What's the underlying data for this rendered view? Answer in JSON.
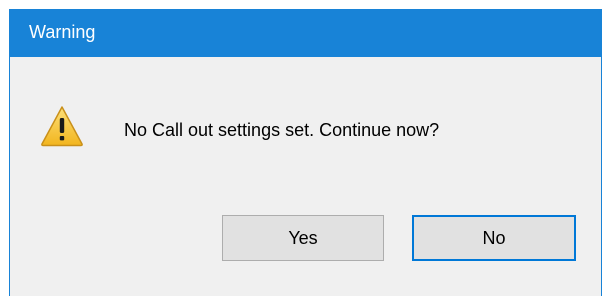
{
  "dialog": {
    "title": "Warning",
    "icon": "warning-icon",
    "message": "No Call out settings set. Continue now?",
    "buttons": {
      "yes_label": "Yes",
      "no_label": "No"
    },
    "default_button": "No"
  },
  "colors": {
    "titlebar": "#1883d7",
    "dialog_background": "#f0f0f0",
    "button_background": "#e1e1e1",
    "focus_border": "#0078d7",
    "warning_yellow": "#f6c23c"
  }
}
